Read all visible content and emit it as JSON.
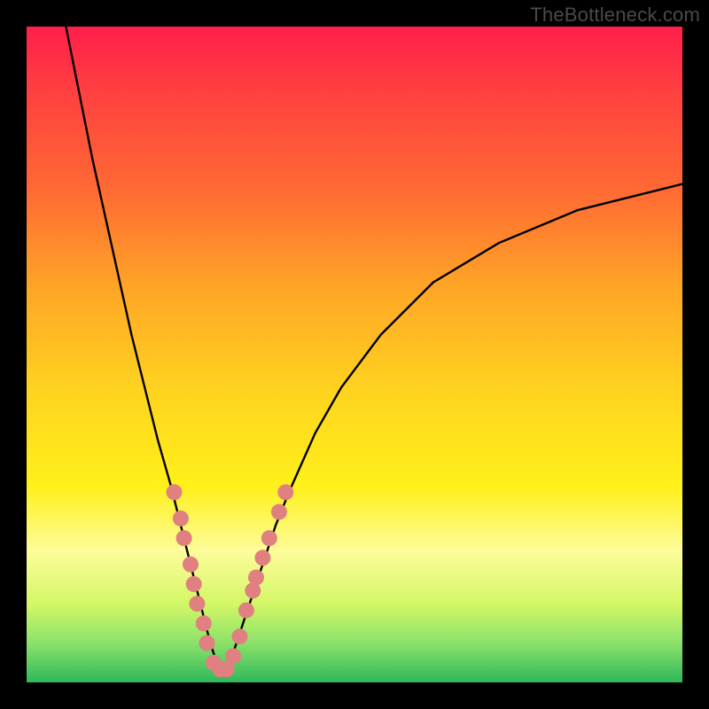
{
  "watermark": "TheBottleneck.com",
  "chart_data": {
    "type": "line",
    "title": "",
    "xlabel": "",
    "ylabel": "",
    "xlim": [
      0,
      100
    ],
    "ylim": [
      0,
      100
    ],
    "series": [
      {
        "name": "curve",
        "x": [
          6,
          8,
          10,
          12,
          14,
          16,
          18,
          20,
          22,
          24,
          25,
          26,
          27,
          28,
          29,
          30,
          31,
          32,
          34,
          36,
          38,
          40,
          44,
          48,
          54,
          62,
          72,
          84,
          100
        ],
        "y": [
          100,
          90,
          80,
          71,
          62,
          53,
          45,
          37,
          30,
          22,
          18,
          14,
          10,
          6,
          3,
          2,
          3,
          6,
          12,
          18,
          24,
          29,
          38,
          45,
          53,
          61,
          67,
          72,
          76
        ]
      }
    ],
    "markers": {
      "name": "dots",
      "color": "#e08080",
      "points": [
        {
          "x": 22.5,
          "y": 29
        },
        {
          "x": 23.5,
          "y": 25
        },
        {
          "x": 24.0,
          "y": 22
        },
        {
          "x": 25.0,
          "y": 18
        },
        {
          "x": 25.5,
          "y": 15
        },
        {
          "x": 26.0,
          "y": 12
        },
        {
          "x": 27.0,
          "y": 9
        },
        {
          "x": 27.5,
          "y": 6
        },
        {
          "x": 28.5,
          "y": 3
        },
        {
          "x": 29.5,
          "y": 2
        },
        {
          "x": 30.5,
          "y": 2
        },
        {
          "x": 31.5,
          "y": 4
        },
        {
          "x": 32.5,
          "y": 7
        },
        {
          "x": 33.5,
          "y": 11
        },
        {
          "x": 34.5,
          "y": 14
        },
        {
          "x": 35.0,
          "y": 16
        },
        {
          "x": 36.0,
          "y": 19
        },
        {
          "x": 37.0,
          "y": 22
        },
        {
          "x": 38.5,
          "y": 26
        },
        {
          "x": 39.5,
          "y": 29
        }
      ]
    }
  }
}
